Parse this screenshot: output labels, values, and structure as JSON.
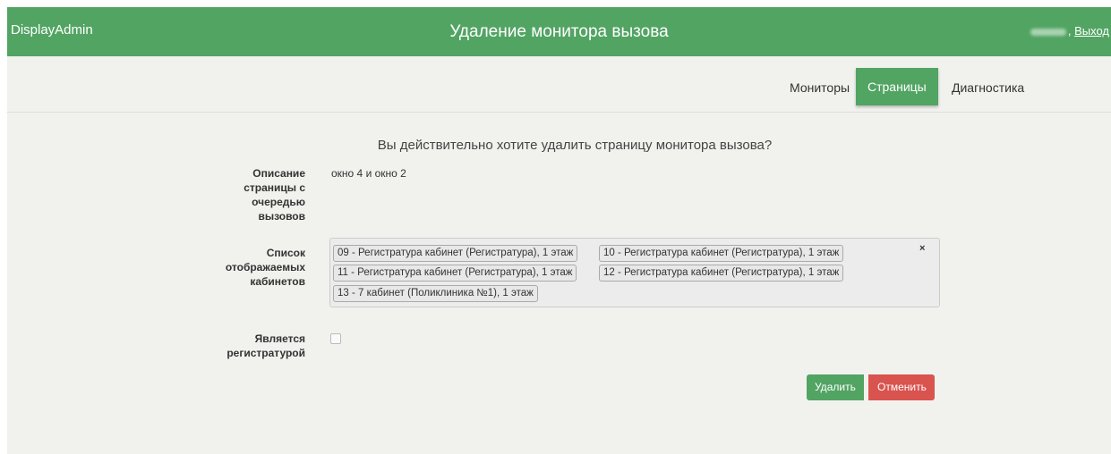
{
  "header": {
    "brand": "DisplayAdmin",
    "title": "Удаление монитора вызова",
    "logout": "Выход"
  },
  "nav": {
    "items": [
      {
        "label": "Мониторы",
        "active": false
      },
      {
        "label": "Страницы",
        "active": true
      },
      {
        "label": "Диагностика",
        "active": false
      }
    ]
  },
  "form": {
    "question": "Вы действительно хотите удалить страницу монитора вызова?",
    "description_label": [
      "Описание",
      "страницы с",
      "очередью",
      "вызовов"
    ],
    "description_value": "окно 4 и окно 2",
    "cabinets_label": [
      "Список",
      "отображаемых",
      "кабинетов"
    ],
    "cabinets": [
      "09 - Регистратура кабинет (Регистратура), 1 этаж",
      "10 - Регистратура кабинет (Регистратура), 1 этаж",
      "11 - Регистратура кабинет (Регистратура), 1 этаж",
      "12 - Регистратура кабинет (Регистратура), 1 этаж",
      "13 - 7 кабинет (Поликлиника №1), 1 этаж"
    ],
    "clear_symbol": "×",
    "registry_label": [
      "Является",
      "регистратурой"
    ],
    "registry_checked": false
  },
  "actions": {
    "delete": "Удалить",
    "cancel": "Отменить"
  },
  "colors": {
    "primary": "#52a463",
    "danger": "#d9534f",
    "background": "#f1f2ee"
  }
}
